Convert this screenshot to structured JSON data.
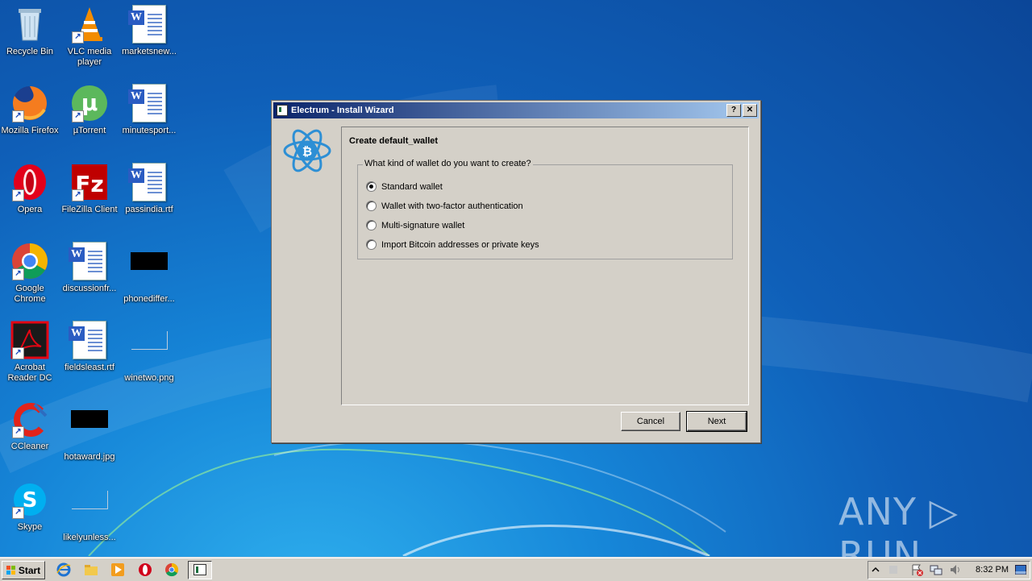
{
  "desktop": {
    "icons": [
      {
        "label": "Recycle Bin"
      },
      {
        "label": "VLC media player"
      },
      {
        "label": "marketsnew..."
      },
      {
        "label": "Mozilla Firefox"
      },
      {
        "label": "µTorrent"
      },
      {
        "label": "minutesport..."
      },
      {
        "label": "Opera"
      },
      {
        "label": "FileZilla Client"
      },
      {
        "label": "passindia.rtf"
      },
      {
        "label": "Google Chrome"
      },
      {
        "label": "discussionfr..."
      },
      {
        "label": "phonediffer..."
      },
      {
        "label": "Acrobat Reader DC"
      },
      {
        "label": "fieldsleast.rtf"
      },
      {
        "label": "winetwo.png"
      },
      {
        "label": "CCleaner"
      },
      {
        "label": "hotaward.jpg"
      },
      {
        "label": "Skype"
      },
      {
        "label": "likelyunless..."
      }
    ]
  },
  "dialog": {
    "title": "Electrum  -  Install Wizard",
    "help_btn": "?",
    "close_btn": "✕",
    "heading": "Create default_wallet",
    "question": "What kind of wallet do you want to create?",
    "options": [
      {
        "label": "Standard wallet",
        "checked": true
      },
      {
        "label": "Wallet with two-factor authentication",
        "checked": false
      },
      {
        "label": "Multi-signature wallet",
        "checked": false
      },
      {
        "label": "Import Bitcoin addresses or private keys",
        "checked": false
      }
    ],
    "cancel": "Cancel",
    "next": "Next"
  },
  "taskbar": {
    "start": "Start",
    "clock": "8:32 PM"
  },
  "watermark": "ANY ▷ RUN"
}
